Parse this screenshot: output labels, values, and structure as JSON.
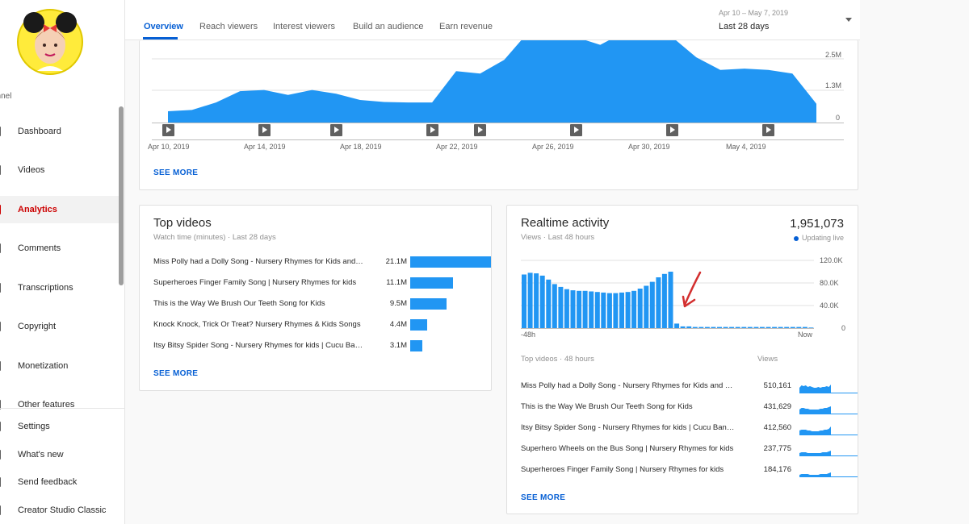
{
  "sidebar": {
    "channel_label": "annel",
    "items": [
      {
        "label": "Dashboard",
        "icon": "dashboard-icon"
      },
      {
        "label": "Videos",
        "icon": "videos-icon"
      },
      {
        "label": "Analytics",
        "icon": "analytics-icon",
        "active": true
      },
      {
        "label": "Comments",
        "icon": "comments-icon"
      },
      {
        "label": "Transcriptions",
        "icon": "transcriptions-icon"
      },
      {
        "label": "Copyright",
        "icon": "copyright-icon"
      },
      {
        "label": "Monetization",
        "icon": "monetization-icon"
      },
      {
        "label": "Other features",
        "icon": "other-features-icon"
      },
      {
        "label": "Settings",
        "icon": "settings-icon"
      },
      {
        "label": "What's new",
        "icon": "whats-new-icon"
      },
      {
        "label": "Send feedback",
        "icon": "feedback-icon"
      },
      {
        "label": "Creator Studio Classic",
        "icon": "classic-studio-icon"
      }
    ]
  },
  "header": {
    "tabs": [
      "Overview",
      "Reach viewers",
      "Interest viewers",
      "Build an audience",
      "Earn revenue"
    ],
    "active_tab": "Overview",
    "date_range": "Apr 10 – May 7, 2019",
    "date_label": "Last 28 days"
  },
  "overview": {
    "see_more": "SEE MORE",
    "y_ticks": [
      "2.5M",
      "1.3M",
      "0"
    ],
    "x_ticks": [
      "Apr 10, 2019",
      "Apr 14, 2019",
      "Apr 18, 2019",
      "Apr 22, 2019",
      "Apr 26, 2019",
      "Apr 30, 2019",
      "May 4, 2019"
    ]
  },
  "top_videos": {
    "title": "Top videos",
    "subtitle": "Watch time (minutes) · Last 28 days",
    "see_more": "SEE MORE",
    "rows": [
      {
        "title": "Miss Polly had a Dolly Song - Nursery Rhymes for Kids and Baby Songs",
        "value": "21.1M",
        "fraction": 1.0
      },
      {
        "title": "Superheroes Finger Family Song | Nursery Rhymes for kids",
        "value": "11.1M",
        "fraction": 0.526
      },
      {
        "title": "This is the Way We Brush Our Teeth Song for Kids",
        "value": "9.5M",
        "fraction": 0.45
      },
      {
        "title": "Knock Knock, Trick Or Treat? Nursery Rhymes & Kids Songs",
        "value": "4.4M",
        "fraction": 0.209
      },
      {
        "title": "Itsy Bitsy Spider Song - Nursery Rhymes for kids | Cucu Banana",
        "value": "3.1M",
        "fraction": 0.147
      }
    ]
  },
  "realtime": {
    "title": "Realtime activity",
    "subtitle": "Views · Last 48 hours",
    "total": "1,951,073",
    "live_label": "Updating live",
    "y_ticks": [
      "120.0K",
      "80.0K",
      "40.0K",
      "0"
    ],
    "x_start": "-48h",
    "x_end": "Now",
    "list_header": "Top videos · 48 hours",
    "views_header": "Views",
    "see_more": "SEE MORE",
    "rows": [
      {
        "title": "Miss Polly had a Dolly Song - Nursery Rhymes for Kids and Baby Songs",
        "value": "510,161"
      },
      {
        "title": "This is the Way We Brush Our Teeth Song for Kids",
        "value": "431,629"
      },
      {
        "title": "Itsy Bitsy Spider Song - Nursery Rhymes for kids | Cucu Banana",
        "value": "412,560"
      },
      {
        "title": "Superhero Wheels on the Bus Song | Nursery Rhymes for kids",
        "value": "237,775"
      },
      {
        "title": "Superheroes Finger Family Song | Nursery Rhymes for kids",
        "value": "184,176"
      }
    ]
  },
  "chart_data": [
    {
      "type": "area",
      "x": [
        "Apr 10",
        "Apr 11",
        "Apr 12",
        "Apr 13",
        "Apr 14",
        "Apr 15",
        "Apr 16",
        "Apr 17",
        "Apr 18",
        "Apr 19",
        "Apr 20",
        "Apr 21",
        "Apr 22",
        "Apr 23",
        "Apr 24",
        "Apr 25",
        "Apr 26",
        "Apr 27",
        "Apr 28",
        "Apr 29",
        "Apr 30",
        "May 1",
        "May 2",
        "May 3",
        "May 4",
        "May 5",
        "May 6",
        "May 7"
      ],
      "values": [
        0.45,
        0.5,
        0.8,
        1.25,
        1.3,
        1.1,
        1.3,
        1.15,
        0.9,
        0.82,
        0.8,
        0.8,
        2.05,
        1.95,
        2.5,
        3.6,
        3.6,
        3.4,
        3.1,
        3.6,
        3.6,
        3.4,
        2.6,
        2.1,
        2.15,
        2.1,
        1.95,
        0.75
      ],
      "y_ticks": [
        "2.5M",
        "1.3M",
        "0"
      ],
      "x_ticks": [
        "Apr 10, 2019",
        "Apr 14, 2019",
        "Apr 18, 2019",
        "Apr 22, 2019",
        "Apr 26, 2019",
        "Apr 30, 2019",
        "May 4, 2019"
      ],
      "ylim": [
        0,
        3.6
      ],
      "video_markers": [
        "Apr 10",
        "Apr 14",
        "Apr 17",
        "Apr 21",
        "Apr 23",
        "Apr 27",
        "May 1",
        "May 5"
      ],
      "color": "#2196f3"
    },
    {
      "type": "bar",
      "title": "Realtime activity",
      "values": [
        95,
        98,
        97,
        93,
        86,
        78,
        73,
        69,
        67,
        66,
        66,
        65,
        64,
        63,
        62,
        62,
        63,
        64,
        66,
        70,
        75,
        82,
        90,
        96,
        100,
        8,
        3,
        3,
        2,
        2,
        2,
        2,
        2,
        2,
        2,
        2,
        2,
        2,
        2,
        2,
        2,
        2,
        2,
        2,
        2,
        2,
        2,
        1
      ],
      "ylim": [
        0,
        120
      ],
      "y_ticks": [
        "120.0K",
        "80.0K",
        "40.0K",
        "0"
      ],
      "x_ticks": [
        "-48h",
        "Now"
      ],
      "color": "#2196f3"
    }
  ],
  "sparklines": [
    [
      6,
      9,
      8,
      9,
      7,
      8,
      7,
      6,
      6,
      7,
      6,
      7,
      7,
      8,
      7,
      10
    ],
    [
      5,
      7,
      7,
      6,
      6,
      5,
      5,
      5,
      5,
      5,
      6,
      6,
      7,
      7,
      8,
      9
    ],
    [
      5,
      6,
      6,
      6,
      5,
      5,
      4,
      4,
      4,
      4,
      5,
      5,
      6,
      6,
      7,
      10
    ],
    [
      3,
      4,
      4,
      4,
      3,
      3,
      3,
      3,
      3,
      3,
      3,
      4,
      4,
      4,
      5,
      6
    ],
    [
      2,
      3,
      3,
      3,
      3,
      2,
      2,
      2,
      2,
      2,
      3,
      3,
      3,
      3,
      4,
      5
    ]
  ],
  "colors": {
    "accent": "#065fd4",
    "bar": "#2196f3",
    "active_nav": "#cc0000",
    "annotation": "#d32f2f"
  }
}
